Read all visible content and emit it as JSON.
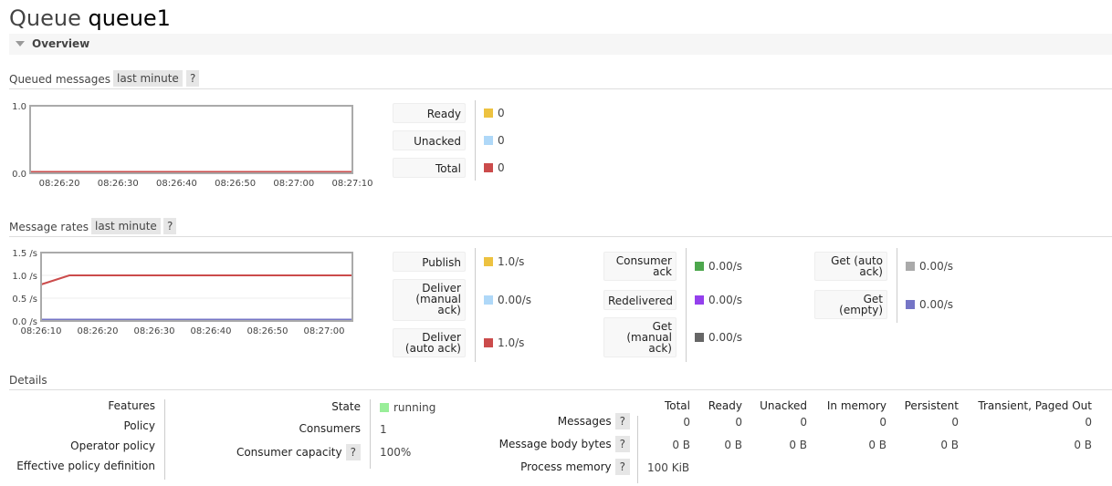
{
  "title": {
    "prefix": "Queue",
    "name": "queue1"
  },
  "overview": {
    "label": "Overview"
  },
  "queued": {
    "label": "Queued messages",
    "range": "last minute",
    "help": "?",
    "legend": [
      {
        "label": "Ready",
        "value": "0",
        "color": "#edc240"
      },
      {
        "label": "Unacked",
        "value": "0",
        "color": "#afd8f8"
      },
      {
        "label": "Total",
        "value": "0",
        "color": "#cb4b4b"
      }
    ]
  },
  "rates": {
    "label": "Message rates",
    "range": "last minute",
    "help": "?",
    "legend": [
      {
        "label": "Publish",
        "value": "1.0/s",
        "color": "#edc240"
      },
      {
        "label": "Deliver (manual ack)",
        "value": "0.00/s",
        "color": "#afd8f8"
      },
      {
        "label": "Deliver (auto ack)",
        "value": "1.0/s",
        "color": "#cb4b4b"
      },
      {
        "label": "Consumer ack",
        "value": "0.00/s",
        "color": "#4da74d"
      },
      {
        "label": "Redelivered",
        "value": "0.00/s",
        "color": "#9440ed"
      },
      {
        "label": "Get (manual ack)",
        "value": "0.00/s",
        "color": "#666666"
      },
      {
        "label": "Get (auto ack)",
        "value": "0.00/s",
        "color": "#aaaaaa"
      },
      {
        "label": "Get (empty)",
        "value": "0.00/s",
        "color": "#7575c6"
      }
    ]
  },
  "chart_data": [
    {
      "type": "line",
      "ylim": [
        0,
        1.0
      ],
      "yticks": [
        "0.0",
        "1.0"
      ],
      "xticks": [
        "08:26:20",
        "08:26:30",
        "08:26:40",
        "08:26:50",
        "08:27:00",
        "08:27:10"
      ],
      "xlim": [
        "08:26:15",
        "08:27:10"
      ],
      "series": [
        {
          "color": "#cb4b4b",
          "x": [
            "08:26:15",
            "08:27:10"
          ],
          "y": [
            0,
            0
          ]
        }
      ]
    },
    {
      "type": "line",
      "ylim": [
        0,
        1.5
      ],
      "yticks": [
        "0.0 /s",
        "0.5 /s",
        "1.0 /s",
        "1.5 /s"
      ],
      "xticks": [
        "08:26:10",
        "08:26:20",
        "08:26:30",
        "08:26:40",
        "08:26:50",
        "08:27:00"
      ],
      "xlim": [
        "08:26:10",
        "08:27:05"
      ],
      "series": [
        {
          "color": "#cb4b4b",
          "x": [
            "08:26:10",
            "08:26:15",
            "08:27:05"
          ],
          "y": [
            0.8,
            1.0,
            1.0
          ]
        },
        {
          "color": "#7575c6",
          "x": [
            "08:26:10",
            "08:27:05"
          ],
          "y": [
            0,
            0
          ]
        }
      ]
    }
  ],
  "details": {
    "label": "Details",
    "left": [
      "Features",
      "Policy",
      "Operator policy",
      "Effective policy definition"
    ],
    "state": {
      "label": "State",
      "value": "running",
      "color": "#99ee99"
    },
    "consumers": {
      "label": "Consumers",
      "value": "1"
    },
    "capacity": {
      "label": "Consumer capacity",
      "value": "100%"
    },
    "help": "?",
    "columns": [
      "Total",
      "Ready",
      "Unacked",
      "In memory",
      "Persistent",
      "Transient, Paged Out"
    ],
    "rows": [
      {
        "label": "Messages",
        "values": [
          "0",
          "0",
          "0",
          "0",
          "0",
          "0"
        ]
      },
      {
        "label": "Message body bytes",
        "values": [
          "0 B",
          "0 B",
          "0 B",
          "0 B",
          "0 B",
          "0 B"
        ]
      },
      {
        "label": "Process memory",
        "values": [
          "100 KiB"
        ]
      }
    ]
  }
}
